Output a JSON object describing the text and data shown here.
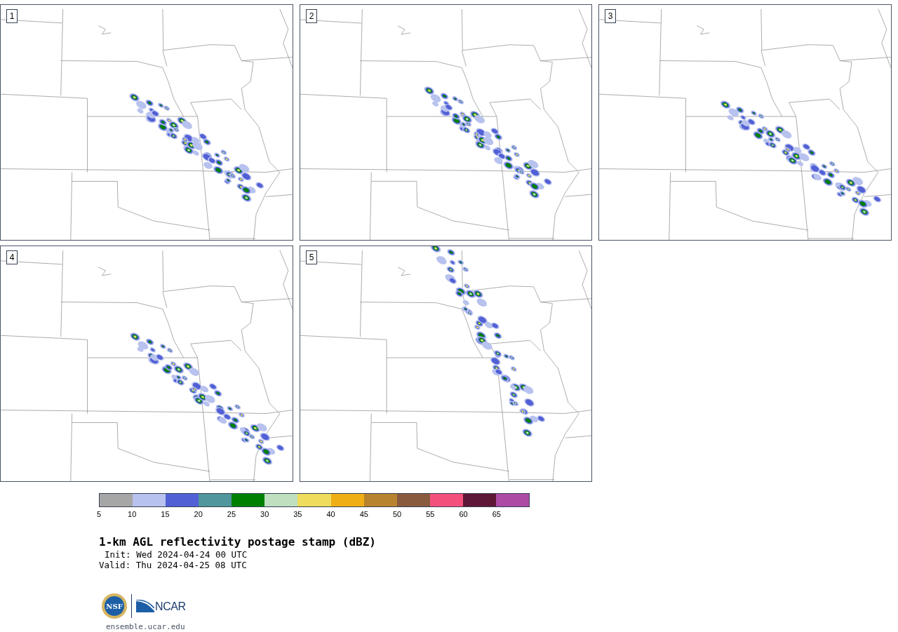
{
  "panels": [
    {
      "label": "1"
    },
    {
      "label": "2"
    },
    {
      "label": "3"
    },
    {
      "label": "4"
    },
    {
      "label": "5"
    }
  ],
  "colorbar": {
    "bins": [
      {
        "color": "#a6a6a6"
      },
      {
        "color": "#b8c2ee"
      },
      {
        "color": "#5260d6"
      },
      {
        "color": "#50969c"
      },
      {
        "color": "#008000"
      },
      {
        "color": "#bfdfbf"
      },
      {
        "color": "#f0dc5c"
      },
      {
        "color": "#f0ae16"
      },
      {
        "color": "#b8832e"
      },
      {
        "color": "#8a5a3e"
      },
      {
        "color": "#f4507c"
      },
      {
        "color": "#5e1736"
      },
      {
        "color": "#ac4aa4"
      }
    ],
    "ticks": [
      "5",
      "10",
      "15",
      "20",
      "25",
      "30",
      "35",
      "40",
      "45",
      "50",
      "55",
      "60",
      "65"
    ]
  },
  "title": "1-km AGL reflectivity postage stamp (dBZ)",
  "init": "Init: Wed 2024-04-24 00 UTC",
  "valid": "Valid: Thu 2024-04-25 08 UTC",
  "logos": {
    "nsf": "NSF",
    "ncar": "NCAR"
  },
  "url": "ensemble.ucar.edu"
}
